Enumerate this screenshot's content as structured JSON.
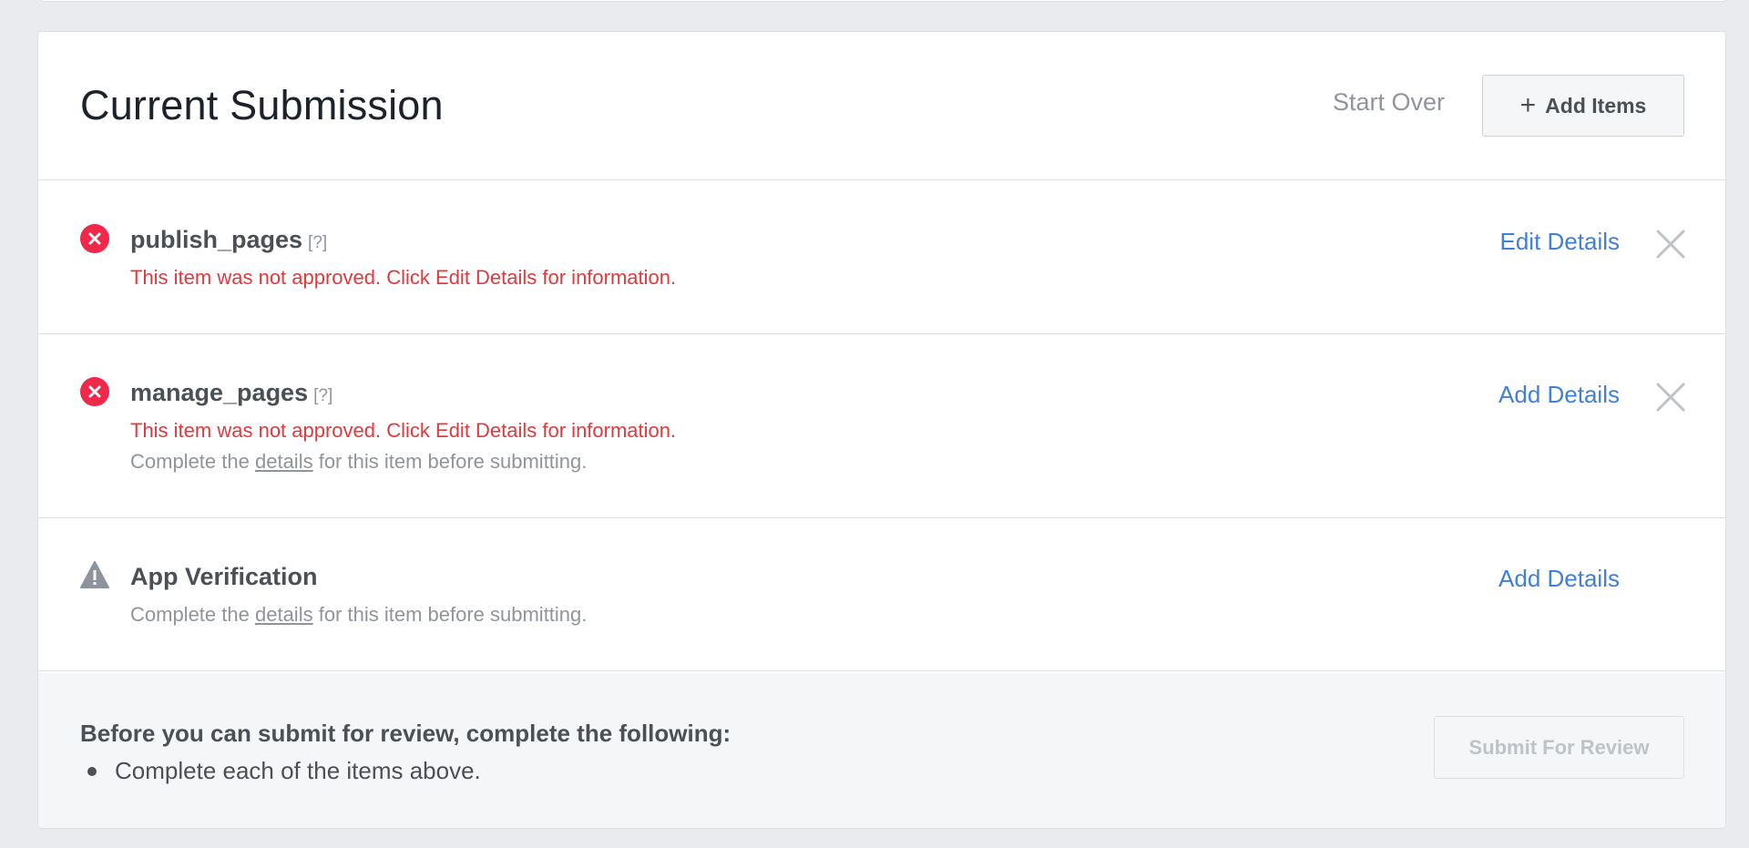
{
  "header": {
    "title": "Current Submission",
    "start_over": "Start Over",
    "add_items": "Add Items"
  },
  "items": [
    {
      "name": "publish_pages",
      "help": "[?]",
      "status": "error",
      "error": "This item was not approved. Click Edit Details for information.",
      "action": "Edit Details",
      "removable": true
    },
    {
      "name": "manage_pages",
      "help": "[?]",
      "status": "error",
      "error": "This item was not approved. Click Edit Details for information.",
      "note_prefix": "Complete the",
      "note_link": "details",
      "note_suffix": "for this item before submitting.",
      "action": "Add Details",
      "removable": true
    },
    {
      "name": "App Verification",
      "status": "warning",
      "note_prefix": "Complete the",
      "note_link": "details",
      "note_suffix": "for this item before submitting.",
      "action": "Add Details",
      "removable": false
    }
  ],
  "footer": {
    "heading": "Before you can submit for review, complete the following:",
    "requirements": [
      "Complete each of the items above."
    ],
    "submit": "Submit For Review"
  },
  "colors": {
    "error": "#e0393e",
    "link": "#4080d8",
    "muted": "#90949c",
    "page_bg": "#e9ebee"
  }
}
